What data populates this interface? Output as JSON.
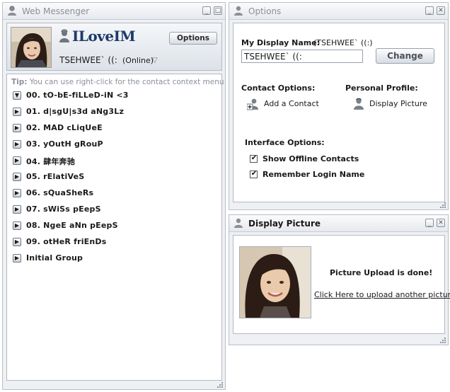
{
  "messenger": {
    "title": "Web Messenger",
    "logo_text": "ILoveIM",
    "options_label": "Options",
    "user_name": "TSEHWEE` ((:",
    "user_status": "(Online)",
    "tip_label": "Tip:",
    "tip_text": " You can use right-click for the contact context menu",
    "groups": [
      {
        "name": "00. tO-bE-fiLLeD-iN <3",
        "expanded": true
      },
      {
        "name": "01. d|sgU|s3d aNg3Lz",
        "expanded": false
      },
      {
        "name": "02. MAD cLiqUeE",
        "expanded": false
      },
      {
        "name": "03. yOutH gRouP",
        "expanded": false
      },
      {
        "name": "04. 肆年奔驰",
        "expanded": false
      },
      {
        "name": "05. rElatiVeS",
        "expanded": false
      },
      {
        "name": "06. sQuaSheRs",
        "expanded": false
      },
      {
        "name": "07. sWiSs pEepS",
        "expanded": false
      },
      {
        "name": "08. NgeE aNn pEepS",
        "expanded": false
      },
      {
        "name": "09. otHeR friEnDs",
        "expanded": false
      },
      {
        "name": "Initial Group",
        "expanded": false
      }
    ]
  },
  "options": {
    "title": "Options",
    "display_name_label": "My Display Name:",
    "display_name_current": " (TSEHWEE` ((:)",
    "display_name_value": "TSEHWEE` ((:",
    "change_label": "Change",
    "contact_options_label": "Contact Options:",
    "add_contact_label": "Add a Contact",
    "personal_profile_label": "Personal Profile:",
    "display_picture_label": "Display Picture",
    "interface_options_label": "Interface Options:",
    "show_offline_label": "Show Offline Contacts",
    "show_offline_checked": true,
    "remember_login_label": "Remember Login Name",
    "remember_login_checked": true
  },
  "display_picture": {
    "title": "Display Picture",
    "status_text": "Picture Upload is done!",
    "upload_link": "Click Here to upload another picture."
  },
  "colors": {
    "logo": "#1d3a6a",
    "window_bg": "#eef0f3",
    "border": "#b9bfc8"
  },
  "icons": {
    "title_icon": "messenger-person-icon",
    "add_contact_icon": "add-contact-icon",
    "display_picture_icon": "profile-person-icon"
  }
}
